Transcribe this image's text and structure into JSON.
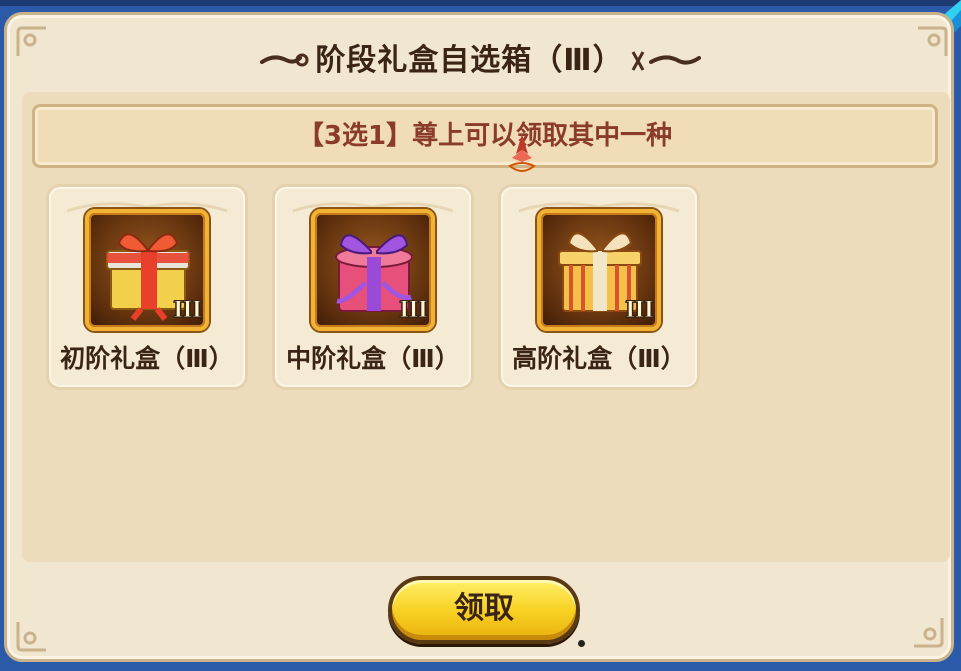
{
  "window": {
    "title": "阶段礼盒自选箱（Ⅲ）"
  },
  "banner": {
    "text": "【3选1】尊上可以领取其中一种"
  },
  "options": [
    {
      "label": "初阶礼盒（Ⅲ）",
      "tier": "III",
      "color": "red",
      "icon": "gift-box-red-icon"
    },
    {
      "label": "中阶礼盒（Ⅲ）",
      "tier": "III",
      "color": "pink-purple",
      "icon": "gift-box-pink-icon"
    },
    {
      "label": "高阶礼盒（Ⅲ）",
      "tier": "III",
      "color": "gold-striped",
      "icon": "gift-box-gold-icon"
    }
  ],
  "actions": {
    "claim_label": "领取"
  },
  "colors": {
    "panel_bg": "#f1e6cf",
    "title_text": "#3a2416",
    "banner_text": "#8a3b2c",
    "button_yellow": "#f8d224",
    "icon_frame_border": "#f2b233"
  }
}
